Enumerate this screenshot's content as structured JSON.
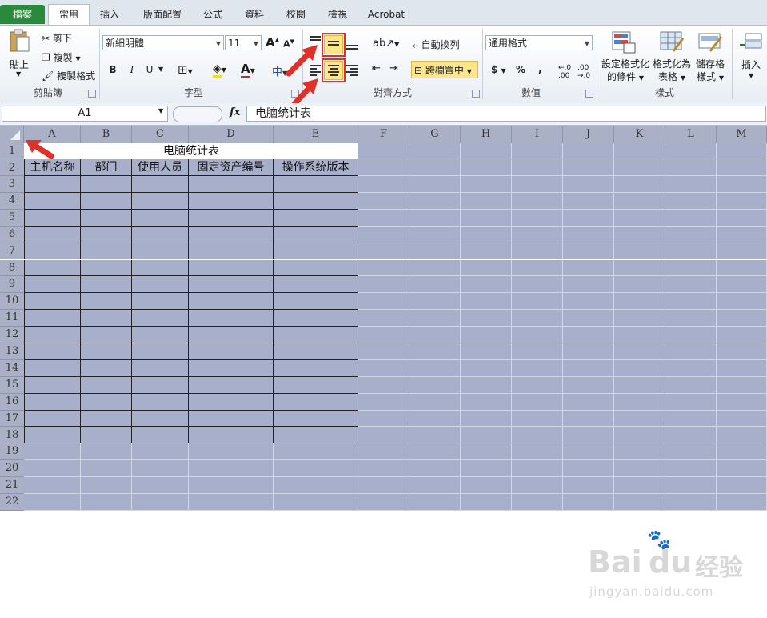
{
  "tabs": [
    "檔案",
    "常用",
    "插入",
    "版面配置",
    "公式",
    "資料",
    "校閱",
    "檢視",
    "Acrobat"
  ],
  "clipboard": {
    "paste": "貼上",
    "cut": "剪下",
    "copy": "複製",
    "format_painter": "複製格式",
    "label": "剪貼簿"
  },
  "font": {
    "name": "新細明體",
    "size": "11",
    "bold": "B",
    "italic": "I",
    "underline": "U",
    "label": "字型"
  },
  "alignment": {
    "wrap_text": "自動換列",
    "merge_center": "跨欄置中",
    "label": "對齊方式"
  },
  "number": {
    "format": "通用格式",
    "currency": "$",
    "percent": "%",
    "comma": ",",
    "label": "數值"
  },
  "styles": {
    "conditional": [
      "設定格式化",
      "的條件"
    ],
    "format_table": [
      "格式化為",
      "表格"
    ],
    "cell_styles": [
      "儲存格",
      "樣式"
    ],
    "label": "樣式"
  },
  "cells": {
    "insert": "插入"
  },
  "formula_bar": {
    "name_box": "A1",
    "fx": "fx",
    "content": "电脑统计表"
  },
  "columns": [
    "A",
    "B",
    "C",
    "D",
    "E",
    "F",
    "G",
    "H",
    "I",
    "J",
    "K",
    "L",
    "M"
  ],
  "rows": [
    "1",
    "2",
    "3",
    "4",
    "5",
    "6",
    "7",
    "8",
    "9",
    "10",
    "11",
    "12",
    "13",
    "14",
    "15",
    "16",
    "17",
    "18",
    "19",
    "20",
    "21",
    "22"
  ],
  "sheet": {
    "title": "电脑统计表",
    "headers": [
      "主机名称",
      "部门",
      "使用人员",
      "固定资产编号",
      "操作系统版本"
    ]
  },
  "watermark": {
    "brand": "Bai",
    "paw": "du",
    "cn": "经验",
    "url": "jingyan.baidu.com"
  },
  "colors": {
    "accent_highlight": "#fde58a",
    "selection": "#a8afca",
    "file_tab": "#2a8a3c",
    "annotation_red": "#e0302a"
  }
}
